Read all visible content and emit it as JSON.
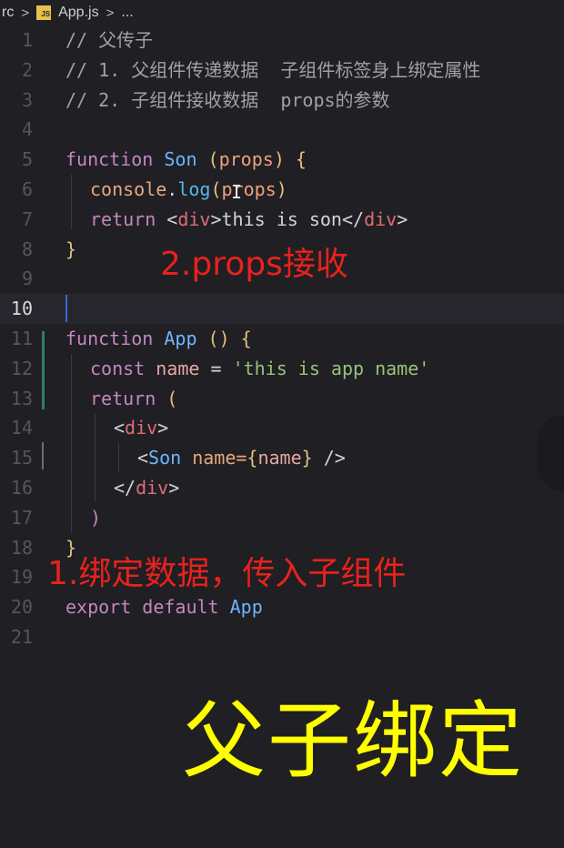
{
  "breadcrumb": {
    "folder": "rc",
    "file_icon": "JS",
    "file": "App.js",
    "more": "..."
  },
  "lines": [
    {
      "n": "1"
    },
    {
      "n": "2"
    },
    {
      "n": "3"
    },
    {
      "n": "4"
    },
    {
      "n": "5"
    },
    {
      "n": "6"
    },
    {
      "n": "7"
    },
    {
      "n": "8"
    },
    {
      "n": "9"
    },
    {
      "n": "10"
    },
    {
      "n": "11"
    },
    {
      "n": "12"
    },
    {
      "n": "13"
    },
    {
      "n": "14"
    },
    {
      "n": "15"
    },
    {
      "n": "16"
    },
    {
      "n": "17"
    },
    {
      "n": "18"
    },
    {
      "n": "19"
    },
    {
      "n": "20"
    },
    {
      "n": "21"
    }
  ],
  "code": {
    "l1": "// 父传子",
    "l2": "// 1. 父组件传递数据  子组件标签身上绑定属性",
    "l3": "// 2. 子组件接收数据  props的参数",
    "l5": {
      "kw": "function",
      "name": "Son",
      "open": " (",
      "param": "props",
      "close": ") {"
    },
    "l6": {
      "obj": "console",
      "dot": ".",
      "method": "log",
      "open": "(",
      "arg": "props",
      "close": ")"
    },
    "l7": {
      "kw": "return",
      "lt": " <",
      "tag": "div",
      "gt": ">",
      "text": "this is son",
      "lt2": "</",
      "tag2": "div",
      "gt2": ">"
    },
    "l8": "}",
    "l11": {
      "kw": "function",
      "name": "App",
      "rest": " () {"
    },
    "l12": {
      "kw": "const",
      "var": "name",
      "eq": " = ",
      "str": "'this is app name'"
    },
    "l13": {
      "kw": "return",
      "open": " ("
    },
    "l14": {
      "lt": "<",
      "tag": "div",
      "gt": ">"
    },
    "l15": {
      "lt": "<",
      "comp": "Son",
      "attr": " name=",
      "brace1": "{",
      "val": "name",
      "brace2": "}",
      "end": " />"
    },
    "l16": {
      "lt": "</",
      "tag": "div",
      "gt": ">"
    },
    "l17": ")",
    "l18": "}",
    "l20": {
      "kw1": "export",
      "kw2": " default",
      "name": " App"
    }
  },
  "current_line": "10",
  "annotations": {
    "props_receive": "2.props接收",
    "bind_data": "1.绑定数据，传入子组件",
    "title": "父子绑定"
  },
  "colors": {
    "background": "#1f1f24",
    "annotation_red": "#e8221c",
    "annotation_yellow": "#ffff00",
    "keyword": "#c586c0",
    "function_name": "#6cb6ff",
    "string": "#98c379"
  }
}
